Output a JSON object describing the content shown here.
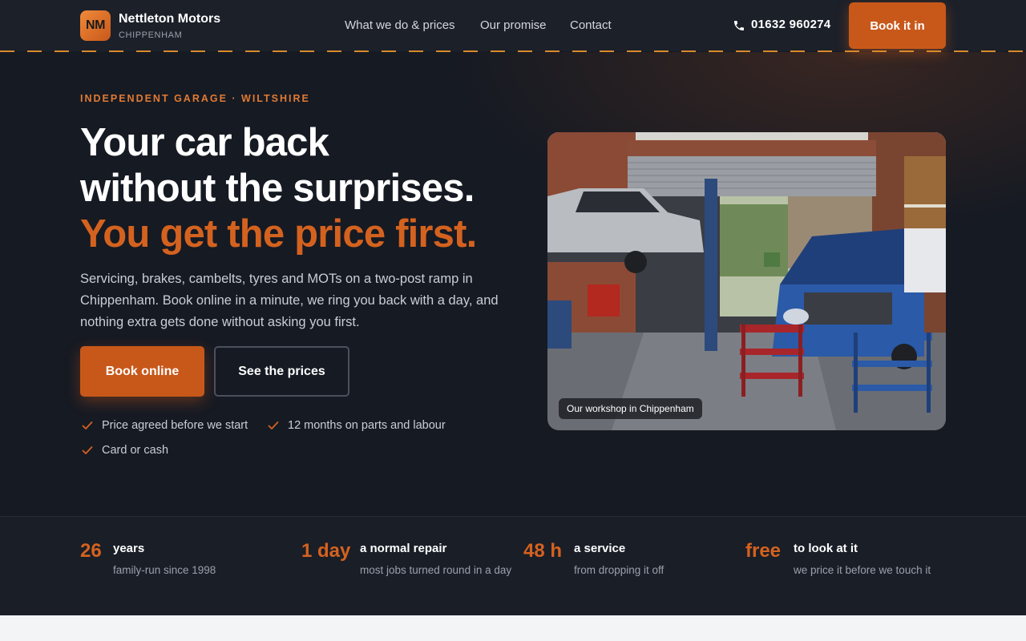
{
  "header": {
    "logo_initials": "NM",
    "brand_name": "Nettleton Motors",
    "brand_location": "CHIPPENHAM",
    "nav": [
      "What we do & prices",
      "Our promise",
      "Contact"
    ],
    "phone": "01632 960274",
    "cta": "Book it in"
  },
  "hero": {
    "eyebrow": "INDEPENDENT GARAGE · WILTSHIRE",
    "headline_line1": "Your car back",
    "headline_line2": "without the surprises.",
    "headline_accent": "You get the price first.",
    "lede": "Servicing, brakes, cambelts, tyres and MOTs on a two-post ramp in Chippenham. Book online in a minute, we ring you back with a day, and nothing extra gets done without asking you first.",
    "primary_button": "Book online",
    "secondary_button": "See the prices",
    "checks": [
      "Price agreed before we start",
      "12 months on parts and labour",
      "Card or cash"
    ],
    "photo_caption": "Our workshop in Chippenham"
  },
  "stats": [
    {
      "value": "26",
      "label": "years",
      "desc": "family-run since 1998"
    },
    {
      "value": "1 day",
      "label": "a normal repair",
      "desc": "most jobs turned round in a day"
    },
    {
      "value": "48 h",
      "label": "a service",
      "desc": "from dropping it off"
    },
    {
      "value": "free",
      "label": "to look at it",
      "desc": "we price it before we touch it"
    }
  ],
  "colors": {
    "accent": "#c8581a",
    "accent_text": "#d4621f",
    "background": "#161a23",
    "header_bg": "#1c2029"
  },
  "icons": {
    "phone": "phone-icon",
    "check": "check-icon"
  }
}
